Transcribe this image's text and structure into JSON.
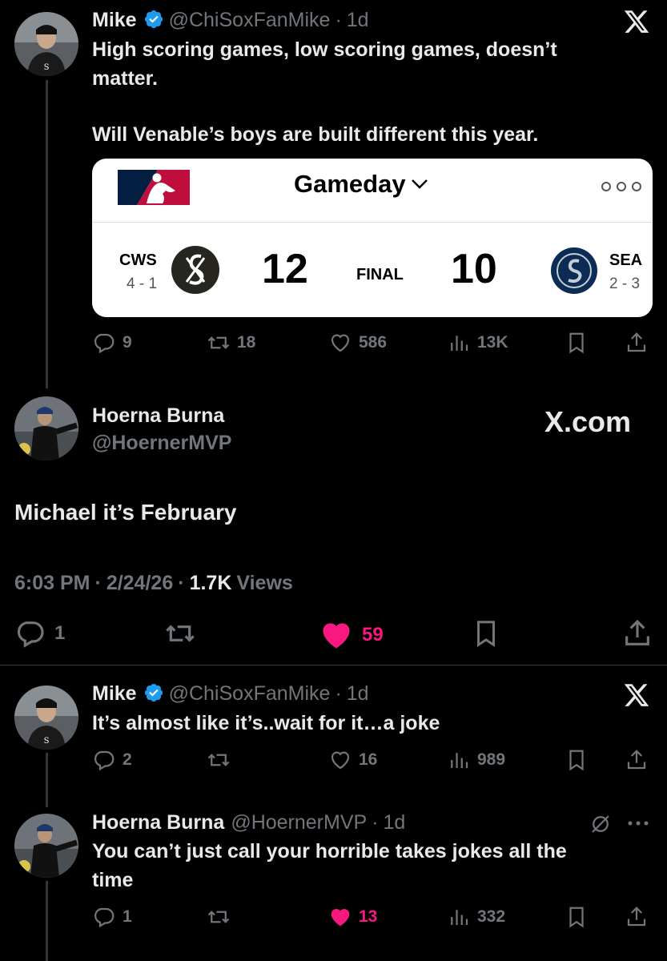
{
  "tweet1": {
    "name": "Mike",
    "handle": "@ChiSoxFanMike",
    "time": "1d",
    "line1": "High scoring games, low scoring games, doesn’t",
    "line2": "matter.",
    "line3": "Will Venable’s boys are built different this year.",
    "card": {
      "title": "Gameday",
      "away_team": "CWS",
      "away_record": "4 - 1",
      "away_score": "12",
      "status": "FINAL",
      "home_score": "10",
      "home_team": "SEA",
      "home_record": "2 - 3"
    },
    "replies": "9",
    "retweets": "18",
    "likes": "586",
    "views": "13K"
  },
  "tweet2": {
    "name": "Hoerna Burna",
    "handle": "@HoernerMVP",
    "watermark": "X.com",
    "text": "Michael it’s February",
    "time": "6:03 PM",
    "date": "2/24/26",
    "views_count": "1.7K",
    "views_label": "Views",
    "replies": "1",
    "likes": "59"
  },
  "tweet3": {
    "name": "Mike",
    "handle": "@ChiSoxFanMike",
    "time": "1d",
    "text": "It’s almost like it’s..wait for it…a joke",
    "replies": "2",
    "likes": "16",
    "views": "989"
  },
  "tweet4": {
    "name": "Hoerna Burna",
    "handle": "@HoernerMVP",
    "time": "1d",
    "line1": "You can’t just call your horrible takes jokes all the",
    "line2": "time",
    "replies": "1",
    "likes": "13",
    "views": "332"
  },
  "sep": "·",
  "colors": {
    "like_active": "#f91880",
    "verified": "#1d9bf0",
    "muted": "#71767b",
    "background": "#000000"
  },
  "icons": [
    "verified-badge-icon",
    "x-logo-icon",
    "reply-icon",
    "retweet-icon",
    "like-icon",
    "views-icon",
    "bookmark-icon",
    "share-icon",
    "grok-icon",
    "more-icon",
    "mlb-logo-icon",
    "white-sox-logo-icon",
    "mariners-logo-icon"
  ]
}
